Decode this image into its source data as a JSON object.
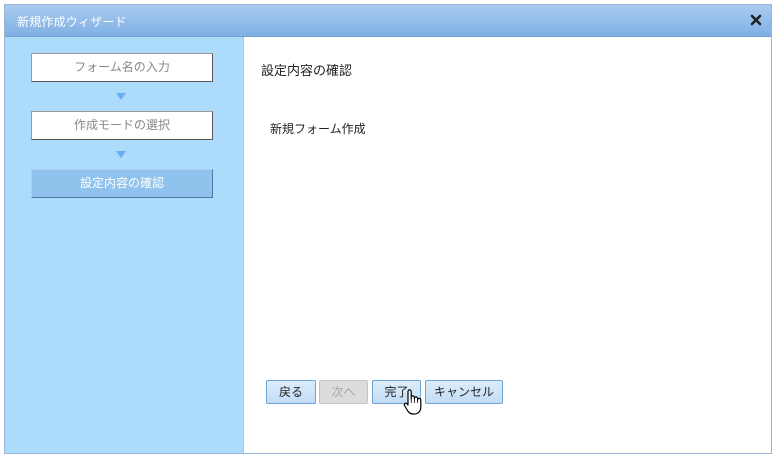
{
  "window": {
    "title": "新規作成ウィザード",
    "close_icon": "close-icon"
  },
  "sidebar": {
    "steps": [
      {
        "label": "フォーム名の入力",
        "active": false
      },
      {
        "label": "作成モードの選択",
        "active": false
      },
      {
        "label": "設定内容の確認",
        "active": true
      }
    ],
    "arrow_icon": "down-triangle-icon"
  },
  "main": {
    "heading": "設定内容の確認",
    "summary": "新規フォーム作成"
  },
  "buttons": {
    "back": "戻る",
    "next": "次へ",
    "finish": "完了",
    "cancel": "キャンセル"
  },
  "colors": {
    "titlebar": "#7fb0e4",
    "sidebar": "#addbfb",
    "active_step": "#8fc3ee",
    "arrow": "#69aef0"
  }
}
